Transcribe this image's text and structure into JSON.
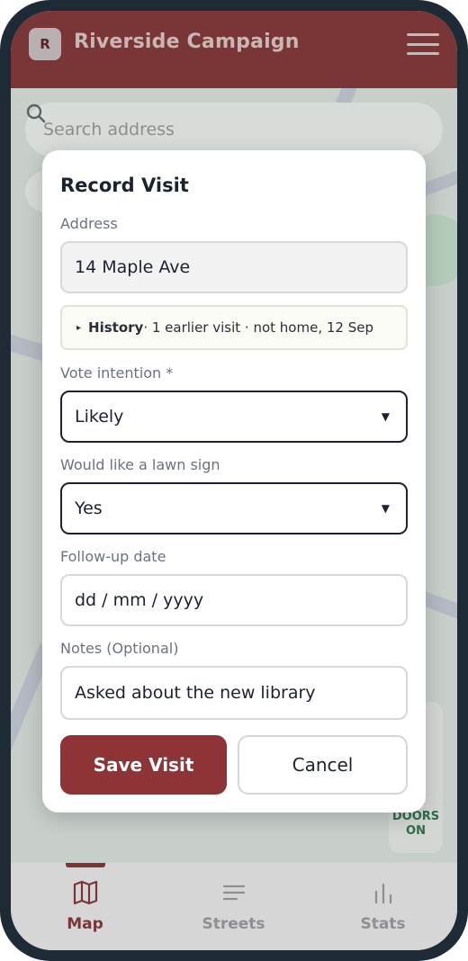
{
  "app": {
    "logo_letter": "R",
    "title": "Riverside Campaign"
  },
  "search": {
    "placeholder": "Search address"
  },
  "map_widget": {
    "doors_label": "DOORS",
    "on_label": "ON"
  },
  "modal": {
    "title": "Record Visit",
    "address": {
      "label": "Address",
      "value": "14 Maple Ave"
    },
    "history": {
      "title": "History",
      "summary": " · 1 earlier visit · not home, 12 Sep"
    },
    "vote_intention": {
      "label": "Vote intention *",
      "value": "Likely"
    },
    "lawn_sign": {
      "label": "Would like a lawn sign",
      "value": "Yes"
    },
    "follow_up": {
      "label": "Follow-up date",
      "placeholder": "dd / mm / yyyy"
    },
    "notes": {
      "label": "Notes (Optional)",
      "value": "Asked about the new library"
    },
    "save_label": "Save Visit",
    "cancel_label": "Cancel"
  },
  "nav": {
    "items": [
      {
        "label": "Map",
        "icon": "map-icon",
        "active": true
      },
      {
        "label": "Streets",
        "icon": "list-icon",
        "active": false
      },
      {
        "label": "Stats",
        "icon": "bar-chart-icon",
        "active": false
      }
    ]
  },
  "colors": {
    "brand": "#7a3537",
    "primary_button": "#8e3336",
    "text": "#1c2230"
  }
}
